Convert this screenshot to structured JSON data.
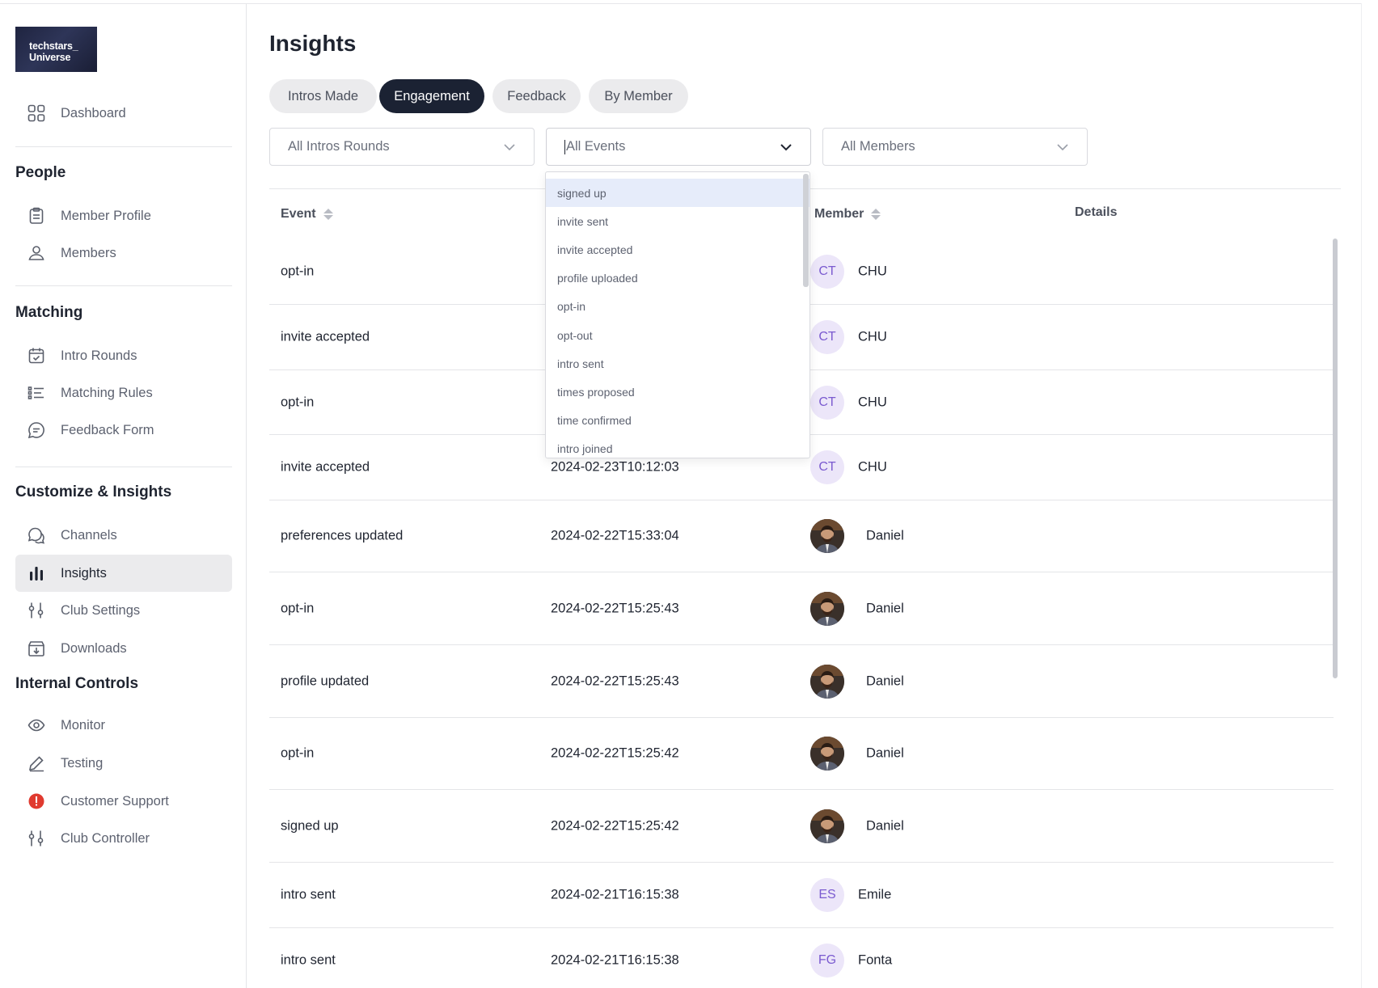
{
  "logo": {
    "line1": "techstars_",
    "line2": "Universe"
  },
  "sidebar": {
    "dashboard": "Dashboard",
    "sections": {
      "people": "People",
      "matching": "Matching",
      "customize": "Customize & Insights",
      "internal": "Internal Controls"
    },
    "items": {
      "member_profile": "Member Profile",
      "members": "Members",
      "intro_rounds": "Intro Rounds",
      "matching_rules": "Matching Rules",
      "feedback_form": "Feedback Form",
      "channels": "Channels",
      "insights": "Insights",
      "club_settings": "Club Settings",
      "downloads": "Downloads",
      "monitor": "Monitor",
      "testing": "Testing",
      "customer_support": "Customer Support",
      "club_controller": "Club Controller"
    },
    "active": "Insights"
  },
  "main": {
    "title": "Insights",
    "tabs": [
      {
        "label": "Intros Made"
      },
      {
        "label": "Engagement",
        "active": true
      },
      {
        "label": "Feedback"
      },
      {
        "label": "By Member"
      }
    ],
    "filters": {
      "rounds": "All Intros Rounds",
      "events": "All Events",
      "members": "All Members"
    },
    "columns": {
      "event": "Event",
      "member": "Member",
      "details": "Details"
    },
    "rows": [
      {
        "event": "opt-in",
        "date": "",
        "initials": "CT",
        "member": "CHU"
      },
      {
        "event": "invite accepted",
        "date": "",
        "initials": "CT",
        "member": "CHU"
      },
      {
        "event": "opt-in",
        "date": "",
        "initials": "CT",
        "member": "CHU"
      },
      {
        "event": "invite accepted",
        "date": "2024-02-23T10:12:03",
        "initials": "CT",
        "member": "CHU"
      },
      {
        "event": "preferences updated",
        "date": "2024-02-22T15:33:04",
        "initials": "",
        "member": "Daniel"
      },
      {
        "event": "opt-in",
        "date": "2024-02-22T15:25:43",
        "initials": "",
        "member": "Daniel"
      },
      {
        "event": "profile updated",
        "date": "2024-02-22T15:25:43",
        "initials": "",
        "member": "Daniel"
      },
      {
        "event": "opt-in",
        "date": "2024-02-22T15:25:42",
        "initials": "",
        "member": "Daniel"
      },
      {
        "event": "signed up",
        "date": "2024-02-22T15:25:42",
        "initials": "",
        "member": "Daniel"
      },
      {
        "event": "intro sent",
        "date": "2024-02-21T16:15:38",
        "initials": "ES",
        "member": "Emile"
      },
      {
        "event": "intro sent",
        "date": "2024-02-21T16:15:38",
        "initials": "FG",
        "member": "Fonta"
      }
    ]
  },
  "events_dropdown": {
    "options": [
      "signed up",
      "invite sent",
      "invite accepted",
      "profile uploaded",
      "opt-in",
      "opt-out",
      "intro sent",
      "times proposed",
      "time confirmed",
      "intro joined"
    ],
    "highlighted": "signed up"
  },
  "colors": {
    "active_tab": "#1b2233",
    "avatar_bg": "#ece6f9",
    "avatar_text": "#7b5bd0",
    "support_icon": "#e03a2f",
    "dropdown_highlight": "#e6ecfa"
  }
}
